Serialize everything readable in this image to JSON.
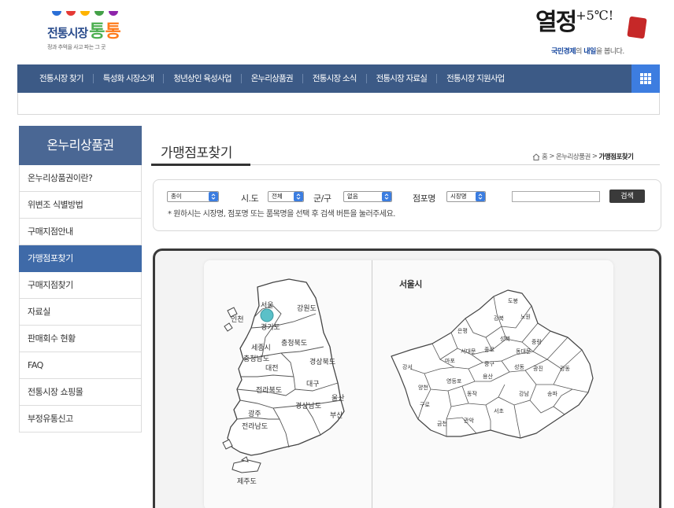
{
  "header": {
    "logo": {
      "text": "전통시장",
      "brand_a": "통",
      "brand_b": "통",
      "tagline": "정과 추억을 사고 파는 그 곳",
      "flag_colors": [
        "#2a6fd6",
        "#e53935",
        "#ffb300",
        "#43a047",
        "#8e24aa"
      ]
    },
    "slogan": {
      "main": "열정",
      "super": "+5℃!",
      "stamp": "",
      "sub_prefix": "국민경제",
      "sub_middle": "의 ",
      "sub_bold": "내일",
      "sub_suffix": "을 봅니다."
    }
  },
  "nav": {
    "items": [
      "전통시장 찾기",
      "특성화 시장소개",
      "청년상인 육성사업",
      "온누리상품권",
      "전통시장 소식",
      "전통시장 자료실",
      "전통시장 지원사업"
    ]
  },
  "sidebar": {
    "title": "온누리상품권",
    "items": [
      "온누리상품권이란?",
      "위변조 식별방법",
      "구매지점안내",
      "가맹점포찾기",
      "구매지점찾기",
      "자료실",
      "판매회수 현황",
      "FAQ",
      "전통시장 쇼핑몰",
      "부정유통신고"
    ],
    "active_index": 3
  },
  "main": {
    "title": "가맹점포찾기",
    "breadcrumb": [
      "홈",
      "온누리상품권",
      "가맹점포찾기"
    ],
    "search": {
      "type_value": "종이",
      "sido_label": "시.도",
      "sido_value": "전체",
      "gungu_label": "군/구",
      "gungu_value": "없음",
      "store_label": "점포명",
      "store_value": "시장명",
      "button_label": "검색",
      "hint": "* 원하시는 시장명, 점포명 또는 품목명을 선택 후 검색 버튼을 눌러주세요."
    },
    "map": {
      "seoul_title": "서울시",
      "korea_regions": [
        "서울",
        "인천",
        "강원도",
        "경기도",
        "세종시",
        "충청북도",
        "충청남도",
        "대전",
        "경상북도",
        "대구",
        "전라북도",
        "울산",
        "경상남도",
        "광주",
        "부산",
        "전라남도",
        "제주도"
      ],
      "seoul_districts": [
        "도봉",
        "강북",
        "노원",
        "은평",
        "성북",
        "중랑",
        "서대문",
        "종로",
        "동대문",
        "강서",
        "마포",
        "중구",
        "성동",
        "광진",
        "강동",
        "양천",
        "영등포",
        "용산",
        "구로",
        "동작",
        "강남",
        "송파",
        "금천",
        "관악",
        "서초"
      ],
      "highlight_color": "#5bc0c8"
    }
  }
}
